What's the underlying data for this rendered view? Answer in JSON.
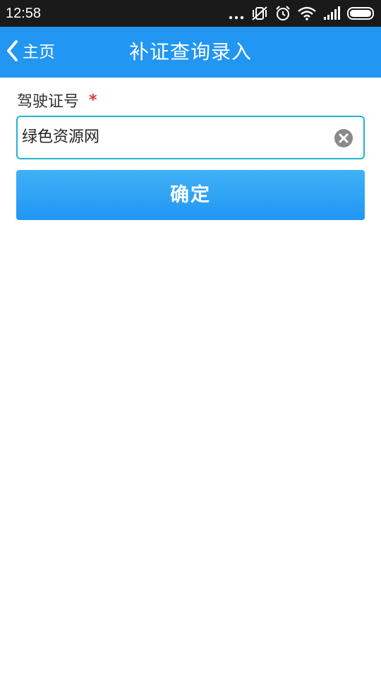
{
  "status_bar": {
    "time": "12:58",
    "icons": [
      "more-dots-icon",
      "vibrate-icon",
      "alarm-icon",
      "wifi-icon",
      "signal-icon",
      "battery-icon"
    ]
  },
  "header": {
    "back_label": "主页",
    "title": "补证查询录入",
    "background": "#2196f3"
  },
  "form": {
    "license_label": "驾驶证号",
    "required_mark": "*",
    "license_value": "绿色资源网",
    "confirm_label": "确定"
  },
  "colors": {
    "accent": "#2196f3",
    "input_border": "#1eb5d8",
    "required": "#e53935"
  }
}
